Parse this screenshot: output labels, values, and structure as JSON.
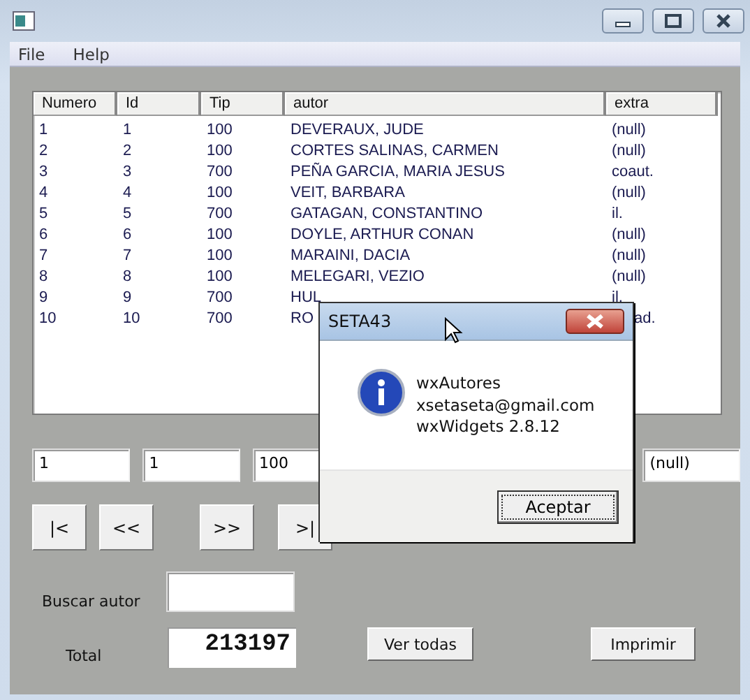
{
  "menu": [
    "File",
    "Help"
  ],
  "table": {
    "columns": [
      "Numero",
      "Id",
      "Tip",
      "autor",
      "extra"
    ],
    "rows": [
      [
        "1",
        "1",
        "100",
        "DEVERAUX, JUDE",
        "(null)"
      ],
      [
        "2",
        "2",
        "100",
        "CORTES SALINAS, CARMEN",
        "(null)"
      ],
      [
        "3",
        "3",
        "700",
        "PEÑA GARCIA, MARIA JESUS",
        "coaut."
      ],
      [
        "4",
        "4",
        "100",
        "VEIT, BARBARA",
        "(null)"
      ],
      [
        "5",
        "5",
        "700",
        "GATAGAN, CONSTANTINO",
        "il."
      ],
      [
        "6",
        "6",
        "100",
        "DOYLE, ARTHUR CONAN",
        "(null)"
      ],
      [
        "7",
        "7",
        "100",
        "MARAINI, DACIA",
        "(null)"
      ],
      [
        "8",
        "8",
        "100",
        "MELEGARI, VEZIO",
        "(null)"
      ],
      [
        "9",
        "9",
        "700",
        "HUL",
        "il."
      ],
      [
        "10",
        "10",
        "700",
        "RO",
        "ad."
      ]
    ]
  },
  "fields": [
    "1",
    "1",
    "100",
    "(null)"
  ],
  "nav_buttons": [
    "|<",
    "<<",
    ">>",
    ">|"
  ],
  "search": {
    "label": "Buscar autor"
  },
  "total": {
    "label": "Total",
    "value": "213197"
  },
  "buttons": [
    "Ver todas",
    "Imprimir"
  ],
  "dialog": {
    "title": "SETA43",
    "lines": [
      "wxAutores",
      "xsetaseta@gmail.com",
      "wxWidgets 2.8.12"
    ],
    "button": "Aceptar"
  }
}
